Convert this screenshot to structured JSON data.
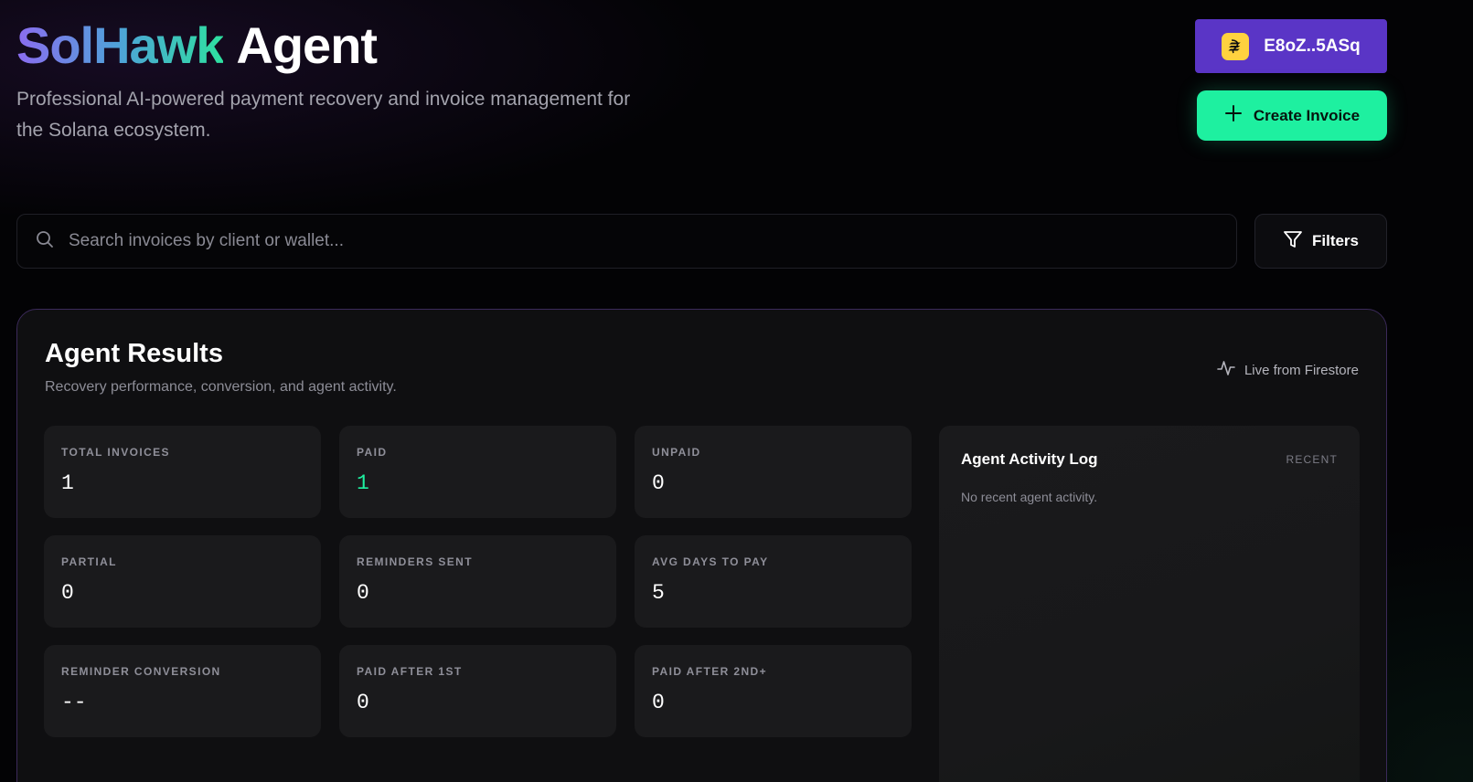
{
  "header": {
    "brand_part1": "SolHawk",
    "brand_part2": "Agent",
    "subtitle": "Professional AI-powered payment recovery and invoice management for the Solana ecosystem."
  },
  "wallet": {
    "address": "E8oZ..5ASq",
    "icon": "solana-logo-icon",
    "color": "#5a35c6"
  },
  "create_invoice": {
    "label": "Create Invoice",
    "icon": "plus-icon",
    "color": "#1ef0a0"
  },
  "search": {
    "placeholder": "Search invoices by client or wallet...",
    "value": "",
    "icon": "search-icon"
  },
  "filters": {
    "label": "Filters",
    "icon": "filter-icon"
  },
  "results": {
    "title": "Agent Results",
    "subtitle": "Recovery performance, conversion, and agent activity.",
    "live_label": "Live from Firestore",
    "live_icon": "activity-pulse-icon",
    "stats": [
      {
        "label": "TOTAL INVOICES",
        "value": "1"
      },
      {
        "label": "PAID",
        "value": "1"
      },
      {
        "label": "UNPAID",
        "value": "0"
      },
      {
        "label": "PARTIAL",
        "value": "0"
      },
      {
        "label": "REMINDERS SENT",
        "value": "0"
      },
      {
        "label": "AVG DAYS TO PAY",
        "value": "5"
      },
      {
        "label": "REMINDER CONVERSION",
        "value": "--"
      },
      {
        "label": "PAID AFTER 1ST",
        "value": "0"
      },
      {
        "label": "PAID AFTER 2ND+",
        "value": "0"
      }
    ],
    "activity_log": {
      "title": "Agent Activity Log",
      "tag": "RECENT",
      "empty_message": "No recent agent activity."
    }
  },
  "colors": {
    "accent_green": "#1ef0a0",
    "brand_purple": "#5a35c6",
    "panel_border": "#3b2a5a"
  }
}
